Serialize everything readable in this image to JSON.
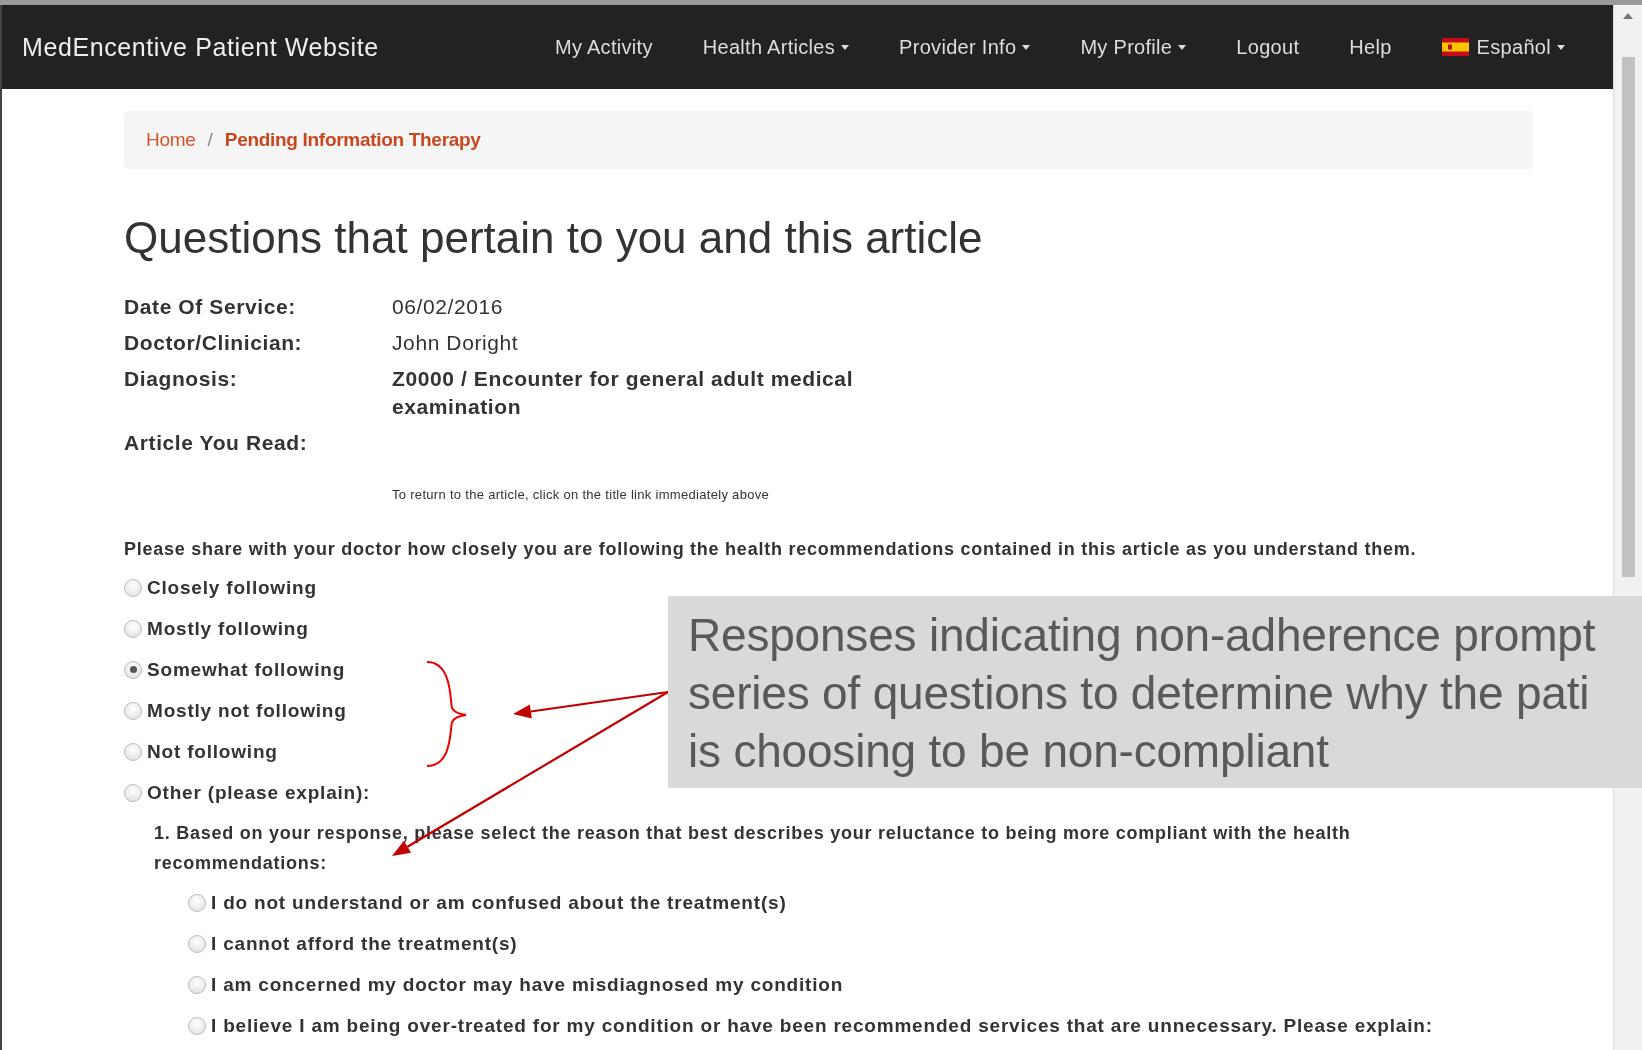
{
  "navbar": {
    "brand": "MedEncentive Patient Website",
    "items": [
      {
        "label": "My Activity",
        "kind": "link"
      },
      {
        "label": "Health Articles",
        "kind": "dropdown"
      },
      {
        "label": "Provider Info",
        "kind": "dropdown"
      },
      {
        "label": "My Profile",
        "kind": "dropdown"
      },
      {
        "label": "Logout",
        "kind": "link"
      },
      {
        "label": "Help",
        "kind": "link"
      },
      {
        "label": "Español",
        "kind": "language"
      }
    ]
  },
  "breadcrumb": {
    "separator": "/",
    "items": [
      {
        "label": "Home",
        "selected": false
      },
      {
        "label": "Pending Information Therapy",
        "selected": true
      }
    ]
  },
  "heading": "Questions that pertain to you and this article",
  "details": [
    {
      "label": "Date Of Service:",
      "value": "06/02/2016",
      "bold": false
    },
    {
      "label": "Doctor/Clinician:",
      "value": "John Doright",
      "bold": false
    },
    {
      "label": "Diagnosis:",
      "value": "Z0000 / Encounter for general adult medical examination",
      "bold": true
    },
    {
      "label": "Article You Read:"
    }
  ],
  "article_note": "To return to the article, click on the title link immediately above",
  "adherence_question": {
    "prompt": "Please share with your doctor how closely you are following the health recommendations contained in this article as you understand them.",
    "options": [
      {
        "label": "Closely following",
        "selected": false
      },
      {
        "label": "Mostly following",
        "selected": false
      },
      {
        "label": "Somewhat following",
        "selected": true
      },
      {
        "label": "Mostly not following",
        "selected": false
      },
      {
        "label": "Not following",
        "selected": false
      },
      {
        "label": "Other (please explain):",
        "selected": false
      }
    ]
  },
  "reason_question": {
    "prompt": "1. Based on your response, please select the reason that best describes your reluctance to being more compliant with the health recommendations:",
    "options": [
      {
        "label": "I do not understand or am confused about the treatment(s)",
        "selected": false
      },
      {
        "label": "I cannot afford the treatment(s)",
        "selected": false
      },
      {
        "label": "I am concerned my doctor may have misdiagnosed my condition",
        "selected": false
      },
      {
        "label": "I believe I am being over-treated for my condition or have been recommended services that are unnecessary. Please explain:",
        "selected": false
      }
    ]
  },
  "annotation": {
    "lines": [
      "Responses indicating non-adherence prompt",
      "series of questions to determine why the pati",
      "is choosing to be non-compliant"
    ]
  }
}
